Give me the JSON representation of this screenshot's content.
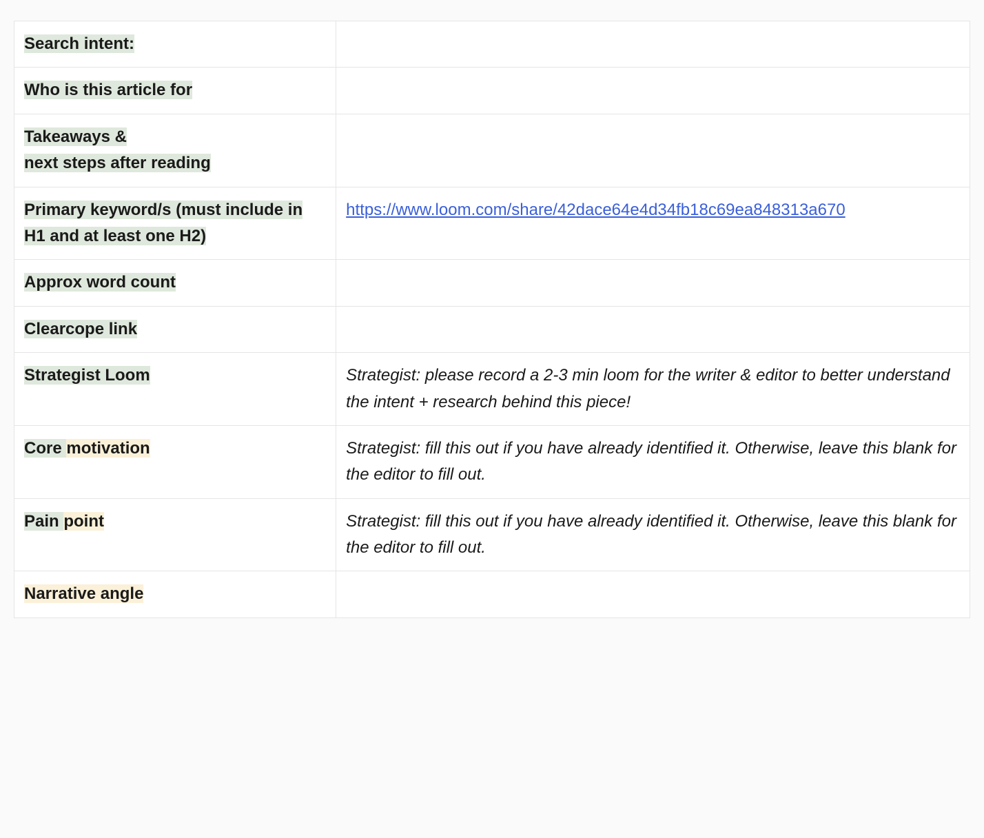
{
  "rows": {
    "search_intent_label": "Search intent:",
    "search_intent_value": "",
    "audience_label": "Who is this article for",
    "audience_value": "",
    "takeaways_label_l1": "Takeaways & ",
    "takeaways_label_l2": "next steps after reading",
    "takeaways_value": "",
    "primary_kw_label": "Primary keyword/s (must include in H1 and at least one H2)",
    "primary_kw_link_text": "https://www.loom.com/share/42dace64e4d34fb18c69ea848313a670",
    "primary_kw_link_href": "https://www.loom.com/share/42dace64e4d34fb18c69ea848313a670",
    "word_count_label": "Approx word count",
    "word_count_value": "",
    "clearcope_label": "Clearcope link",
    "clearcope_value": "",
    "strategist_loom_label": "Strategist Loom",
    "strategist_loom_value": "Strategist: please record a 2-3 min loom for the writer & editor to better understand the intent + research behind this piece!",
    "core_motivation_label_a": "Core ",
    "core_motivation_label_b": "motivation",
    "core_motivation_value": "Strategist: fill this out if you have already identified it. Otherwise, leave this blank for the editor to fill out.",
    "pain_point_label_a": "Pain ",
    "pain_point_label_b": "point",
    "pain_point_value": "Strategist: fill this out if you have already identified it. Otherwise, leave this blank for the editor to fill out.",
    "narrative_label": "Narrative angle",
    "narrative_value": ""
  }
}
